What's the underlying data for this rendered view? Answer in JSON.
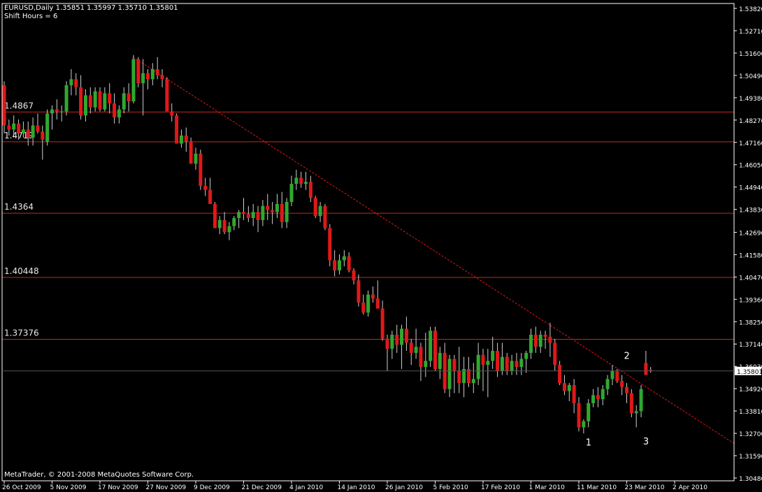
{
  "header": {
    "line1": "EURUSD,Daily  1.35851 1.35997 1.35710 1.35801",
    "line2": "Shift Hours = 6"
  },
  "footer": {
    "copyright": "MetaTrader, © 2001-2008 MetaQuotes Software Corp."
  },
  "colors": {
    "background": "#000000",
    "axis": "#FFFFFF",
    "bull": "#2FA82F",
    "bear": "#E01818",
    "wick": "#CFCFCF",
    "level": "#C8281E",
    "trend": "#E01818",
    "marker": "#FFFFFF"
  },
  "chart_data": {
    "type": "candlestick",
    "symbol": "EURUSD",
    "timeframe": "Daily",
    "ohlc_last": {
      "open": 1.35851,
      "high": 1.35997,
      "low": 1.3571,
      "close": 1.35801
    },
    "current_price_label": "1.35801",
    "ylim": [
      1.3048,
      1.3838
    ],
    "y_ticks": [
      "1.53820",
      "1.52710",
      "1.51600",
      "1.50490",
      "1.49380",
      "1.48270",
      "1.47160",
      "1.46050",
      "1.44940",
      "1.43830",
      "1.42690",
      "1.41580",
      "1.40470",
      "1.39360",
      "1.38250",
      "1.37140",
      "1.36030",
      "1.34920",
      "1.33810",
      "1.32700",
      "1.31590",
      "1.30480"
    ],
    "x_ticks": [
      "26 Oct 2009",
      "5 Nov 2009",
      "17 Nov 2009",
      "27 Nov 2009",
      "9 Dec 2009",
      "21 Dec 2009",
      "4 Jan 2010",
      "14 Jan 2010",
      "26 Jan 2010",
      "5 Feb 2010",
      "17 Feb 2010",
      "1 Mar 2010",
      "11 Mar 2010",
      "23 Mar 2010",
      "2 Apr 2010"
    ],
    "levels": [
      {
        "value": 1.4867,
        "label": "1.4867"
      },
      {
        "value": 1.4719,
        "label": "1.4719"
      },
      {
        "value": 1.4364,
        "label": "1.4364"
      },
      {
        "value": 1.40448,
        "label": "1.40448"
      },
      {
        "value": 1.37376,
        "label": "1.37376"
      }
    ],
    "trendline": {
      "from_price": 1.514,
      "to_price": 1.322,
      "style": "dashed"
    },
    "markers": [
      {
        "label": "1",
        "price": 1.3265
      },
      {
        "label": "2",
        "price": 1.3612
      },
      {
        "label": "3",
        "price": 1.327
      }
    ],
    "candles": [
      [
        1.5,
        1.502,
        1.476,
        1.48
      ],
      [
        1.48,
        1.483,
        1.475,
        1.478
      ],
      [
        1.478,
        1.485,
        1.474,
        1.481
      ],
      [
        1.481,
        1.483,
        1.473,
        1.476
      ],
      [
        1.476,
        1.482,
        1.474,
        1.478
      ],
      [
        1.478,
        1.482,
        1.47,
        1.474
      ],
      [
        1.474,
        1.484,
        1.47,
        1.48
      ],
      [
        1.48,
        1.486,
        1.476,
        1.477
      ],
      [
        1.477,
        1.48,
        1.463,
        1.473
      ],
      [
        1.472,
        1.488,
        1.47,
        1.486
      ],
      [
        1.486,
        1.49,
        1.478,
        1.488
      ],
      [
        1.488,
        1.493,
        1.483,
        1.487
      ],
      [
        1.487,
        1.49,
        1.482,
        1.487
      ],
      [
        1.487,
        1.502,
        1.485,
        1.5
      ],
      [
        1.5,
        1.508,
        1.495,
        1.503
      ],
      [
        1.503,
        1.506,
        1.495,
        1.499
      ],
      [
        1.499,
        1.505,
        1.483,
        1.485
      ],
      [
        1.485,
        1.498,
        1.482,
        1.495
      ],
      [
        1.495,
        1.499,
        1.486,
        1.489
      ],
      [
        1.489,
        1.499,
        1.487,
        1.497
      ],
      [
        1.497,
        1.499,
        1.487,
        1.488
      ],
      [
        1.488,
        1.499,
        1.487,
        1.496
      ],
      [
        1.496,
        1.501,
        1.486,
        1.491
      ],
      [
        1.491,
        1.496,
        1.481,
        1.484
      ],
      [
        1.484,
        1.49,
        1.481,
        1.488
      ],
      [
        1.488,
        1.499,
        1.486,
        1.496
      ],
      [
        1.496,
        1.501,
        1.487,
        1.492
      ],
      [
        1.492,
        1.515,
        1.491,
        1.513
      ],
      [
        1.513,
        1.514,
        1.499,
        1.501
      ],
      [
        1.501,
        1.513,
        1.485,
        1.506
      ],
      [
        1.506,
        1.508,
        1.498,
        1.503
      ],
      [
        1.503,
        1.511,
        1.5,
        1.508
      ],
      [
        1.508,
        1.514,
        1.503,
        1.505
      ],
      [
        1.505,
        1.508,
        1.499,
        1.503
      ],
      [
        1.503,
        1.504,
        1.488,
        1.487
      ],
      [
        1.487,
        1.491,
        1.482,
        1.485
      ],
      [
        1.485,
        1.486,
        1.471,
        1.471
      ],
      [
        1.471,
        1.478,
        1.469,
        1.475
      ],
      [
        1.475,
        1.479,
        1.467,
        1.472
      ],
      [
        1.472,
        1.474,
        1.461,
        1.461
      ],
      [
        1.461,
        1.469,
        1.458,
        1.466
      ],
      [
        1.466,
        1.468,
        1.448,
        1.45
      ],
      [
        1.45,
        1.454,
        1.445,
        1.448
      ],
      [
        1.448,
        1.454,
        1.441,
        1.441
      ],
      [
        1.441,
        1.442,
        1.429,
        1.429
      ],
      [
        1.429,
        1.435,
        1.426,
        1.433
      ],
      [
        1.433,
        1.437,
        1.426,
        1.427
      ],
      [
        1.427,
        1.432,
        1.423,
        1.43
      ],
      [
        1.43,
        1.435,
        1.428,
        1.434
      ],
      [
        1.434,
        1.438,
        1.429,
        1.437
      ],
      [
        1.437,
        1.444,
        1.433,
        1.436
      ],
      [
        1.436,
        1.44,
        1.432,
        1.434
      ],
      [
        1.434,
        1.441,
        1.43,
        1.437
      ],
      [
        1.437,
        1.44,
        1.427,
        1.433
      ],
      [
        1.433,
        1.443,
        1.43,
        1.44
      ],
      [
        1.44,
        1.446,
        1.433,
        1.438
      ],
      [
        1.438,
        1.442,
        1.431,
        1.437
      ],
      [
        1.437,
        1.446,
        1.434,
        1.441
      ],
      [
        1.441,
        1.447,
        1.429,
        1.432
      ],
      [
        1.432,
        1.444,
        1.429,
        1.442
      ],
      [
        1.442,
        1.455,
        1.44,
        1.451
      ],
      [
        1.451,
        1.458,
        1.448,
        1.454
      ],
      [
        1.454,
        1.457,
        1.449,
        1.451
      ],
      [
        1.451,
        1.457,
        1.448,
        1.452
      ],
      [
        1.452,
        1.455,
        1.442,
        1.444
      ],
      [
        1.444,
        1.445,
        1.434,
        1.435
      ],
      [
        1.435,
        1.442,
        1.432,
        1.44
      ],
      [
        1.44,
        1.441,
        1.428,
        1.429
      ],
      [
        1.429,
        1.431,
        1.41,
        1.413
      ],
      [
        1.413,
        1.418,
        1.405,
        1.408
      ],
      [
        1.408,
        1.416,
        1.406,
        1.413
      ],
      [
        1.413,
        1.418,
        1.41,
        1.415
      ],
      [
        1.415,
        1.417,
        1.407,
        1.408
      ],
      [
        1.408,
        1.409,
        1.401,
        1.403
      ],
      [
        1.403,
        1.406,
        1.39,
        1.392
      ],
      [
        1.392,
        1.396,
        1.386,
        1.387
      ],
      [
        1.387,
        1.398,
        1.385,
        1.396
      ],
      [
        1.396,
        1.4,
        1.392,
        1.394
      ],
      [
        1.394,
        1.403,
        1.392,
        1.389
      ],
      [
        1.389,
        1.393,
        1.373,
        1.374
      ],
      [
        1.374,
        1.376,
        1.358,
        1.369
      ],
      [
        1.369,
        1.378,
        1.364,
        1.376
      ],
      [
        1.376,
        1.381,
        1.367,
        1.371
      ],
      [
        1.371,
        1.381,
        1.359,
        1.379
      ],
      [
        1.379,
        1.385,
        1.368,
        1.372
      ],
      [
        1.372,
        1.374,
        1.361,
        1.367
      ],
      [
        1.367,
        1.379,
        1.364,
        1.37
      ],
      [
        1.37,
        1.372,
        1.353,
        1.36
      ],
      [
        1.36,
        1.377,
        1.355,
        1.363
      ],
      [
        1.363,
        1.38,
        1.36,
        1.378
      ],
      [
        1.378,
        1.38,
        1.358,
        1.359
      ],
      [
        1.359,
        1.37,
        1.354,
        1.367
      ],
      [
        1.367,
        1.372,
        1.347,
        1.349
      ],
      [
        1.349,
        1.366,
        1.345,
        1.364
      ],
      [
        1.364,
        1.366,
        1.347,
        1.358
      ],
      [
        1.358,
        1.37,
        1.347,
        1.352
      ],
      [
        1.352,
        1.365,
        1.345,
        1.359
      ],
      [
        1.359,
        1.365,
        1.35,
        1.352
      ],
      [
        1.352,
        1.362,
        1.347,
        1.354
      ],
      [
        1.354,
        1.372,
        1.351,
        1.366
      ],
      [
        1.366,
        1.369,
        1.348,
        1.361
      ],
      [
        1.361,
        1.369,
        1.345,
        1.363
      ],
      [
        1.363,
        1.375,
        1.359,
        1.368
      ],
      [
        1.368,
        1.372,
        1.355,
        1.358
      ],
      [
        1.358,
        1.372,
        1.356,
        1.365
      ],
      [
        1.365,
        1.367,
        1.356,
        1.358
      ],
      [
        1.358,
        1.366,
        1.356,
        1.363
      ],
      [
        1.363,
        1.367,
        1.356,
        1.36
      ],
      [
        1.36,
        1.367,
        1.356,
        1.364
      ],
      [
        1.364,
        1.368,
        1.357,
        1.367
      ],
      [
        1.367,
        1.379,
        1.364,
        1.376
      ],
      [
        1.376,
        1.38,
        1.367,
        1.37
      ],
      [
        1.37,
        1.378,
        1.367,
        1.376
      ],
      [
        1.376,
        1.378,
        1.369,
        1.375
      ],
      [
        1.375,
        1.382,
        1.365,
        1.372
      ],
      [
        1.372,
        1.374,
        1.358,
        1.361
      ],
      [
        1.361,
        1.363,
        1.351,
        1.352
      ],
      [
        1.352,
        1.356,
        1.346,
        1.348
      ],
      [
        1.348,
        1.352,
        1.343,
        1.351
      ],
      [
        1.351,
        1.354,
        1.337,
        1.342
      ],
      [
        1.342,
        1.345,
        1.328,
        1.33
      ],
      [
        1.33,
        1.334,
        1.327,
        1.333
      ],
      [
        1.333,
        1.344,
        1.33,
        1.342
      ],
      [
        1.342,
        1.349,
        1.34,
        1.346
      ],
      [
        1.346,
        1.35,
        1.34,
        1.344
      ],
      [
        1.344,
        1.351,
        1.341,
        1.349
      ],
      [
        1.349,
        1.356,
        1.346,
        1.354
      ],
      [
        1.354,
        1.361,
        1.351,
        1.358
      ],
      [
        1.358,
        1.359,
        1.352,
        1.353
      ],
      [
        1.353,
        1.356,
        1.346,
        1.35
      ],
      [
        1.35,
        1.352,
        1.342,
        1.347
      ],
      [
        1.347,
        1.349,
        1.335,
        1.337
      ],
      [
        1.337,
        1.341,
        1.33,
        1.338
      ],
      [
        1.338,
        1.351,
        1.335,
        1.349
      ],
      [
        1.362,
        1.368,
        1.356,
        1.356
      ],
      [
        1.3585,
        1.36,
        1.3571,
        1.358
      ]
    ]
  }
}
